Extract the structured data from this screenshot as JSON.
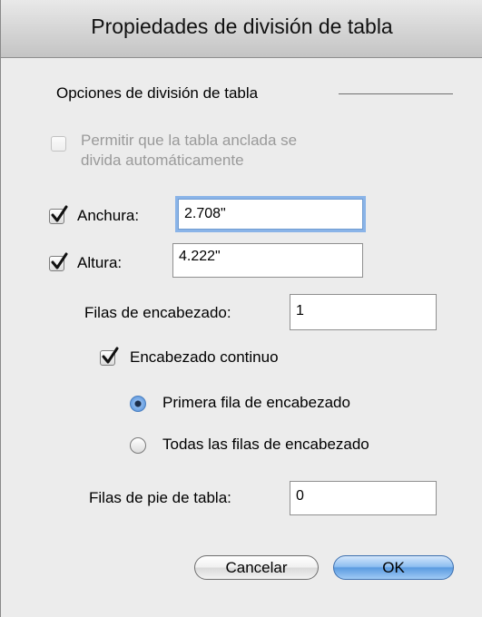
{
  "dialog": {
    "title": "Propiedades de división de tabla",
    "group_title": "Opciones de división de tabla",
    "auto_split": {
      "line1": "Permitir que la tabla anclada se",
      "line2": "divida automáticamente",
      "checked": false,
      "enabled": false
    },
    "width": {
      "label": "Anchura:",
      "value": "2.708\"",
      "checked": true
    },
    "height": {
      "label": "Altura:",
      "value": "4.222\"",
      "checked": true
    },
    "header_rows": {
      "label": "Filas de encabezado:",
      "value": "1"
    },
    "continuous_header": {
      "label": "Encabezado continuo",
      "checked": true
    },
    "header_options": [
      {
        "label": "Primera fila de encabezado",
        "selected": true
      },
      {
        "label": "Todas las filas de encabezado",
        "selected": false
      }
    ],
    "footer_rows": {
      "label": "Filas de pie de tabla:",
      "value": "0"
    },
    "buttons": {
      "cancel": "Cancelar",
      "ok": "OK"
    }
  }
}
